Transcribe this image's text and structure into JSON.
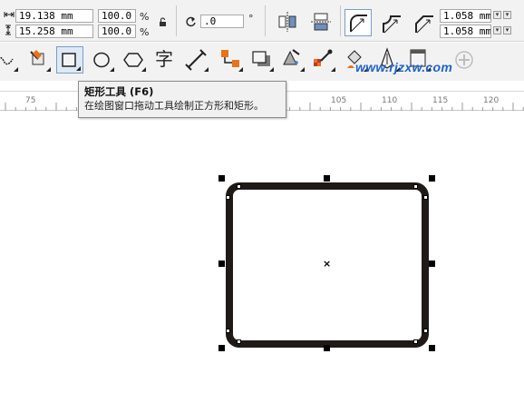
{
  "property_bar": {
    "width_value": "19.138 mm",
    "height_value": "15.258 mm",
    "scale_x": "100.0",
    "scale_y": "100.0",
    "percent_x": "%",
    "percent_y": "%",
    "rotation_value": ".0",
    "degree_symbol": "°",
    "corner_radius_top": "1.058 mm",
    "corner_radius_bottom": "1.058 mm",
    "icons": [
      "width-icon",
      "height-icon",
      "lock-icon",
      "rotate-icon",
      "mirror-horizontal-icon",
      "mirror-vertical-icon",
      "round-corner-icon",
      "scallop-corner-icon",
      "chamfer-corner-icon"
    ]
  },
  "toolbox": {
    "active_tool": "rectangle-tool",
    "tools": [
      "freehand-tool",
      "smart-fill-tool",
      "rectangle-tool",
      "ellipse-tool",
      "polygon-tool",
      "text-tool",
      "dimension-tool",
      "connector-tool",
      "drop-shadow-tool",
      "transparency-tool",
      "eyedropper-tool",
      "fill-tool",
      "outline-pen-tool",
      "table-tool",
      "add-tool"
    ],
    "text_tool_glyph": "字",
    "add_glyph": "+"
  },
  "watermark": "www.rjzxw.com",
  "ruler": {
    "labels": [
      "75",
      "105",
      "110",
      "115",
      "120"
    ]
  },
  "tooltip": {
    "title": "矩形工具 (F6)",
    "description": "在绘图窗口拖动工具绘制正方形和矩形。"
  },
  "colors": {
    "shape_outline": "#1f1a17",
    "watermark": "#1e63c8",
    "panel_bg": "#f2f2f2"
  }
}
